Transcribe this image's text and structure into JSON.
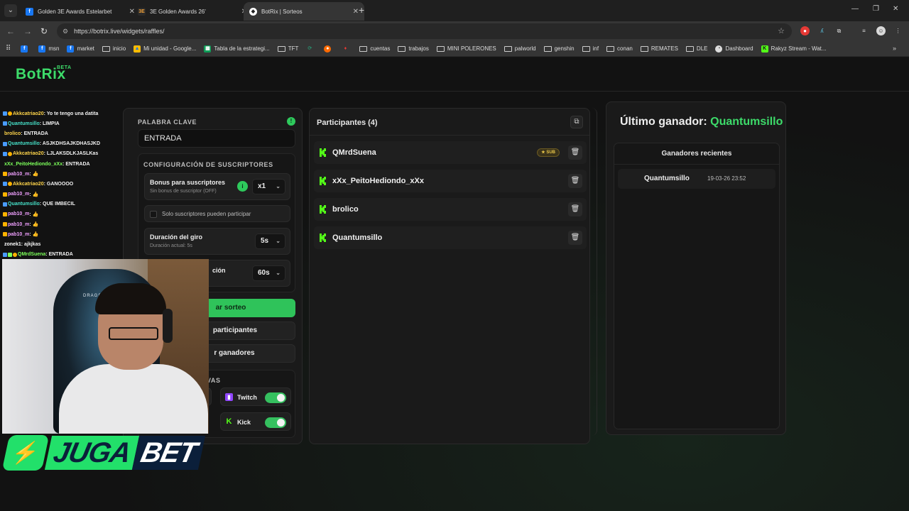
{
  "browser": {
    "tabs": [
      {
        "title": "Golden 3E Awards Estelarbet",
        "favicon": "facebook-icon",
        "active": false
      },
      {
        "title": "3E Golden Awards 26'",
        "favicon": "3e-icon",
        "active": false
      },
      {
        "title": "BotRix | Sorteos",
        "favicon": "botrix-icon",
        "active": true
      }
    ],
    "url": "https://botrix.live/widgets/raffles/",
    "bookmarks": [
      {
        "label": "",
        "icon": "facebook-icon"
      },
      {
        "label": "msn",
        "icon": "facebook-icon"
      },
      {
        "label": "market",
        "icon": "facebook-icon"
      },
      {
        "label": "inicio",
        "icon": "folder-icon"
      },
      {
        "label": "Mi unidad - Google...",
        "icon": "drive-icon"
      },
      {
        "label": "Tabla de la estrategi...",
        "icon": "sheet-icon"
      },
      {
        "label": "TFT",
        "icon": "folder-icon"
      },
      {
        "label": "",
        "icon": "app-icon"
      },
      {
        "label": "",
        "icon": "app-icon"
      },
      {
        "label": "",
        "icon": "app-icon"
      },
      {
        "label": "cuentas",
        "icon": "folder-icon"
      },
      {
        "label": "trabajos",
        "icon": "folder-icon"
      },
      {
        "label": "MINI POLERONES",
        "icon": "folder-icon"
      },
      {
        "label": "palworld",
        "icon": "folder-icon"
      },
      {
        "label": "genshin",
        "icon": "folder-icon"
      },
      {
        "label": "inf",
        "icon": "folder-icon"
      },
      {
        "label": "conan",
        "icon": "folder-icon"
      },
      {
        "label": "REMATES",
        "icon": "folder-icon"
      },
      {
        "label": "DLE",
        "icon": "folder-icon"
      },
      {
        "label": "Dashboard",
        "icon": "dashboard-icon"
      },
      {
        "label": "Rakyz Stream - Wat...",
        "icon": "kick-icon"
      }
    ],
    "more": "»"
  },
  "app": {
    "logo": "BotRix",
    "badge": "BETA"
  },
  "settings": {
    "keyword_label": "PALABRA CLAVE",
    "keyword_value": "ENTRADA",
    "subs_section": "CONFIGURACIÓN DE SUSCRIPTORES",
    "bonus_title": "Bonus para suscriptores",
    "bonus_sub": "Sin bonus de suscriptor (OFF)",
    "bonus_value": "x1",
    "only_subs": "Solo suscriptores pueden participar",
    "spin_title": "Duración del giro",
    "spin_sub": "Duración actual: 5s",
    "spin_value": "5s",
    "announce_title": "ción",
    "announce_value": "60s",
    "start_btn": "ar sorteo",
    "clear_participants_btn": "participantes",
    "clear_winners_btn": "r ganadores",
    "platforms_section": "VAS",
    "platforms": [
      {
        "name": "Twitch",
        "icon": "twitch-icon",
        "enabled": true,
        "color": "#9146ff"
      },
      {
        "name": "Kick",
        "icon": "kick-icon",
        "enabled": true,
        "color": "#53fc18"
      }
    ]
  },
  "participants": {
    "title": "Participantes (4)",
    "sub_badge": "SUB",
    "list": [
      {
        "name": "QMrdSuena",
        "sub": true
      },
      {
        "name": "xXx_PeitoHediondo_xXx",
        "sub": false
      },
      {
        "name": "brolico",
        "sub": false
      },
      {
        "name": "Quantumsillo",
        "sub": false
      }
    ]
  },
  "winners": {
    "title_prefix": "Último ganador:",
    "last_winner": "Quantumsillo",
    "recent_title": "Ganadores recientes",
    "recent": [
      {
        "name": "Quantumsillo",
        "date": "19-03-26 23:52"
      }
    ]
  },
  "chat": [
    {
      "user": "Akkcatriao20",
      "color": "#ffd54a",
      "text": ": Yo te tengo una datita",
      "badges": [
        "#4a9cff",
        "#ffb300"
      ]
    },
    {
      "user": "Quantumsillo",
      "color": "#46e0c8",
      "text": ": LIMPIA",
      "badges": [
        "#4a9cff"
      ]
    },
    {
      "user": "brolico",
      "color": "#ffd54a",
      "text": ": ENTRADA",
      "badges": []
    },
    {
      "user": "Quantumsillo",
      "color": "#46e0c8",
      "text": ": ASJKDHSAJKDHASJKD",
      "badges": [
        "#4a9cff"
      ]
    },
    {
      "user": "Akkcatriao20",
      "color": "#ffd54a",
      "text": ": LJLAKSDLKJASLKas",
      "badges": [
        "#4a9cff",
        "#ffb300"
      ]
    },
    {
      "user": "xXx_PeitoHediondo_xXx",
      "color": "#7cff5a",
      "text": ": ENTRADA",
      "badges": []
    },
    {
      "user": "pab10_m",
      "color": "#f0a0ff",
      "text": ": 👍",
      "badges": [
        "#ffb300"
      ]
    },
    {
      "user": "Akkcatriao20",
      "color": "#ffd54a",
      "text": ": GANOOOO",
      "badges": [
        "#4a9cff",
        "#ffb300"
      ]
    },
    {
      "user": "pab10_m",
      "color": "#f0a0ff",
      "text": ": 👍",
      "badges": [
        "#ffb300"
      ]
    },
    {
      "user": "Quantumsillo",
      "color": "#46e0c8",
      "text": ": QUE IMBECIL",
      "badges": [
        "#4a9cff"
      ]
    },
    {
      "user": "pab10_m",
      "color": "#f0a0ff",
      "text": ": 👍",
      "badges": [
        "#ffb300"
      ]
    },
    {
      "user": "pab10_m",
      "color": "#f0a0ff",
      "text": ": 👍",
      "badges": [
        "#ffb300"
      ]
    },
    {
      "user": "pab10_m",
      "color": "#f0a0ff",
      "text": ": 👍",
      "badges": [
        "#ffb300"
      ]
    },
    {
      "user": "zonek1",
      "color": "#ffffff",
      "text": ": ajkjkas",
      "badges": []
    },
    {
      "user": "QMrdSuena",
      "color": "#7cff5a",
      "text": ": ENTRADA",
      "badges": [
        "#4a9cff",
        "#7cff5a",
        "#ffb300"
      ]
    }
  ],
  "overlay": {
    "webcam_chair_label": "DRAGSTER",
    "sponsor_juga": "JUGA",
    "sponsor_bet": "BET"
  },
  "colors": {
    "accent": "#3ddc6a",
    "background": "#131313",
    "panel": "#1a1a1a"
  }
}
